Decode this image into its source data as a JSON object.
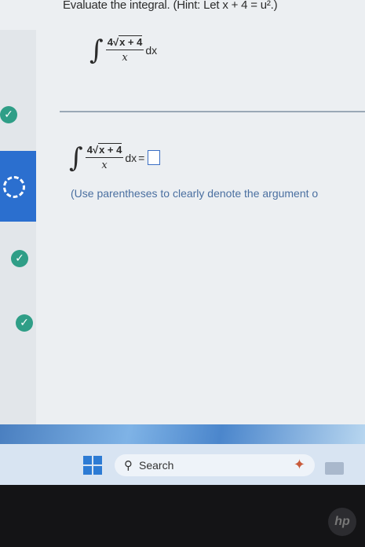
{
  "question": {
    "prompt": "Evaluate the integral. (Hint: Let x + 4 = u².)",
    "integral": {
      "symbol": "∫",
      "coefficient": "4",
      "radicand": "x + 4",
      "denominator": "x",
      "differential": "dx"
    }
  },
  "answer_line": {
    "equals": "=",
    "input_value": "",
    "note": "(Use parentheses to clearly denote the argument o"
  },
  "sidebar": {
    "items": [
      {
        "status": "complete",
        "icon": "check-circle-icon"
      },
      {
        "status": "current",
        "icon": "dashed-circle-icon"
      },
      {
        "status": "complete",
        "icon": "check-circle-icon"
      },
      {
        "status": "complete",
        "icon": "check-circle-icon"
      }
    ]
  },
  "taskbar": {
    "search_label": "Search",
    "start_icon": "windows-start-icon"
  },
  "device": {
    "logo": "hp"
  },
  "colors": {
    "check": "#2f9e87",
    "active_item": "#2b6fcf",
    "note_text": "#4a6fa0",
    "answer_box_border": "#3b6fc4"
  }
}
